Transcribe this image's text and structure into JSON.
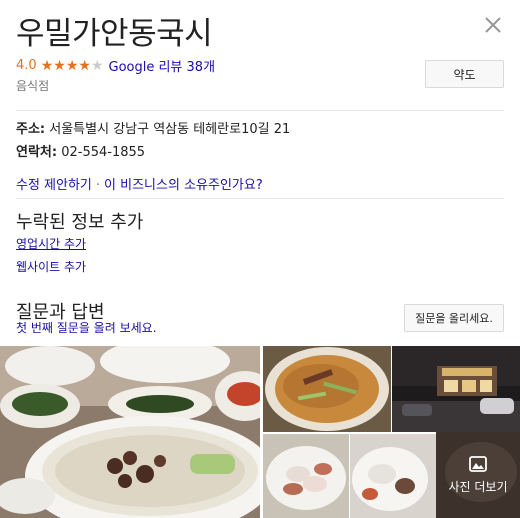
{
  "place": {
    "title": "우밀가안동국시",
    "rating": "4.0",
    "stars_value": 4,
    "stars_max": 5,
    "reviews": "Google 리뷰 38개",
    "category": "음식점"
  },
  "actions": {
    "directions": "약도",
    "close": "close-icon"
  },
  "info": {
    "address_label": "주소:",
    "address": "서울특별시 강남구 역삼동 테헤란로10길 21",
    "phone_label": "연락처:",
    "phone": "02-554-1855"
  },
  "links": {
    "suggest_edit": "수정 제안하기",
    "separator": "·",
    "own_business": "이 비즈니스의 소유주인가요?"
  },
  "missing_info": {
    "heading": "누락된 정보 추가",
    "hours": "영업시간 추가",
    "website": "웹사이트 추가"
  },
  "qa": {
    "heading": "질문과 답변",
    "prompt": "첫 번째 질문을 올려 보세요.",
    "ask_button": "질문을 올리세요."
  },
  "photos": {
    "more_label": "사진 더보기",
    "icon": "photo-icon"
  },
  "colors": {
    "accent_star": "#e7711b",
    "link": "#1a0dab"
  }
}
